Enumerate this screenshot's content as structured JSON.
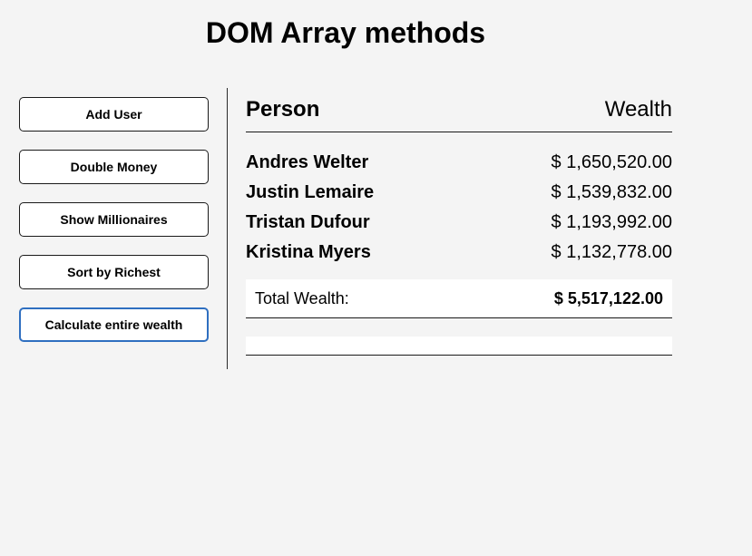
{
  "page": {
    "title": "DOM Array methods"
  },
  "sidebar": {
    "buttons": [
      {
        "label": "Add User"
      },
      {
        "label": "Double Money"
      },
      {
        "label": "Show Millionaires"
      },
      {
        "label": "Sort by Richest"
      },
      {
        "label": "Calculate entire wealth"
      }
    ]
  },
  "main": {
    "header": {
      "person": "Person",
      "wealth": "Wealth"
    },
    "people": [
      {
        "name": "Andres Welter",
        "wealth": "$ 1,650,520.00"
      },
      {
        "name": "Justin Lemaire",
        "wealth": "$ 1,539,832.00"
      },
      {
        "name": "Tristan Dufour",
        "wealth": "$ 1,193,992.00"
      },
      {
        "name": "Kristina Myers",
        "wealth": "$ 1,132,778.00"
      }
    ],
    "total": {
      "label": "Total Wealth:",
      "value": "$ 5,517,122.00"
    }
  },
  "colors": {
    "background": "#f4f4f4",
    "focus_border": "#2f6fc0"
  }
}
